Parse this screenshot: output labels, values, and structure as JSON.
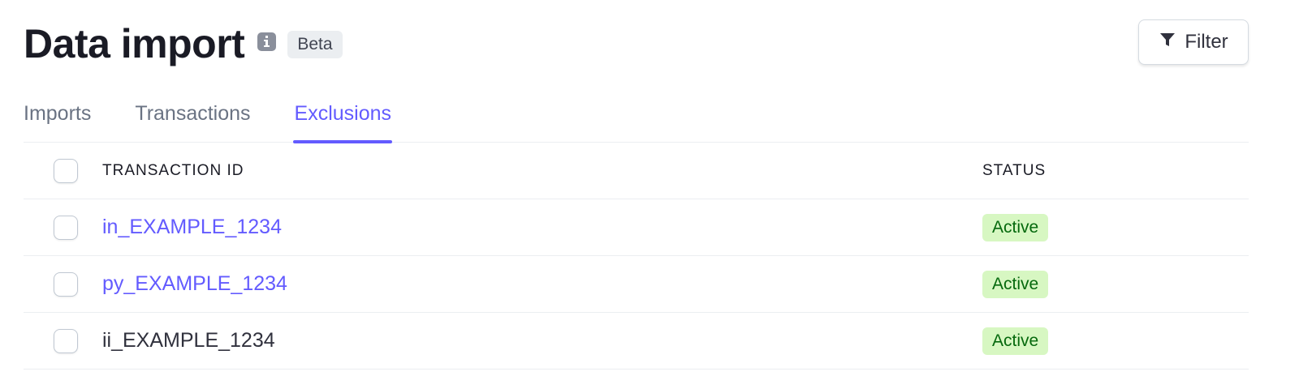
{
  "header": {
    "title": "Data import",
    "info_icon": "info-icon",
    "badge": "Beta",
    "filter_label": "Filter",
    "filter_icon": "filter-funnel-icon"
  },
  "tabs": [
    {
      "label": "Imports",
      "active": false
    },
    {
      "label": "Transactions",
      "active": false
    },
    {
      "label": "Exclusions",
      "active": true
    }
  ],
  "table": {
    "columns": [
      "TRANSACTION ID",
      "STATUS"
    ],
    "rows": [
      {
        "id": "in_EXAMPLE_1234",
        "status": "Active",
        "link": true
      },
      {
        "id": "py_EXAMPLE_1234",
        "status": "Active",
        "link": true
      },
      {
        "id": "ii_EXAMPLE_1234",
        "status": "Active",
        "link": false
      }
    ]
  },
  "colors": {
    "accent": "#635bff",
    "status_bg": "#d7f7c2",
    "status_text": "#05690d",
    "title": "#1a1b25"
  }
}
